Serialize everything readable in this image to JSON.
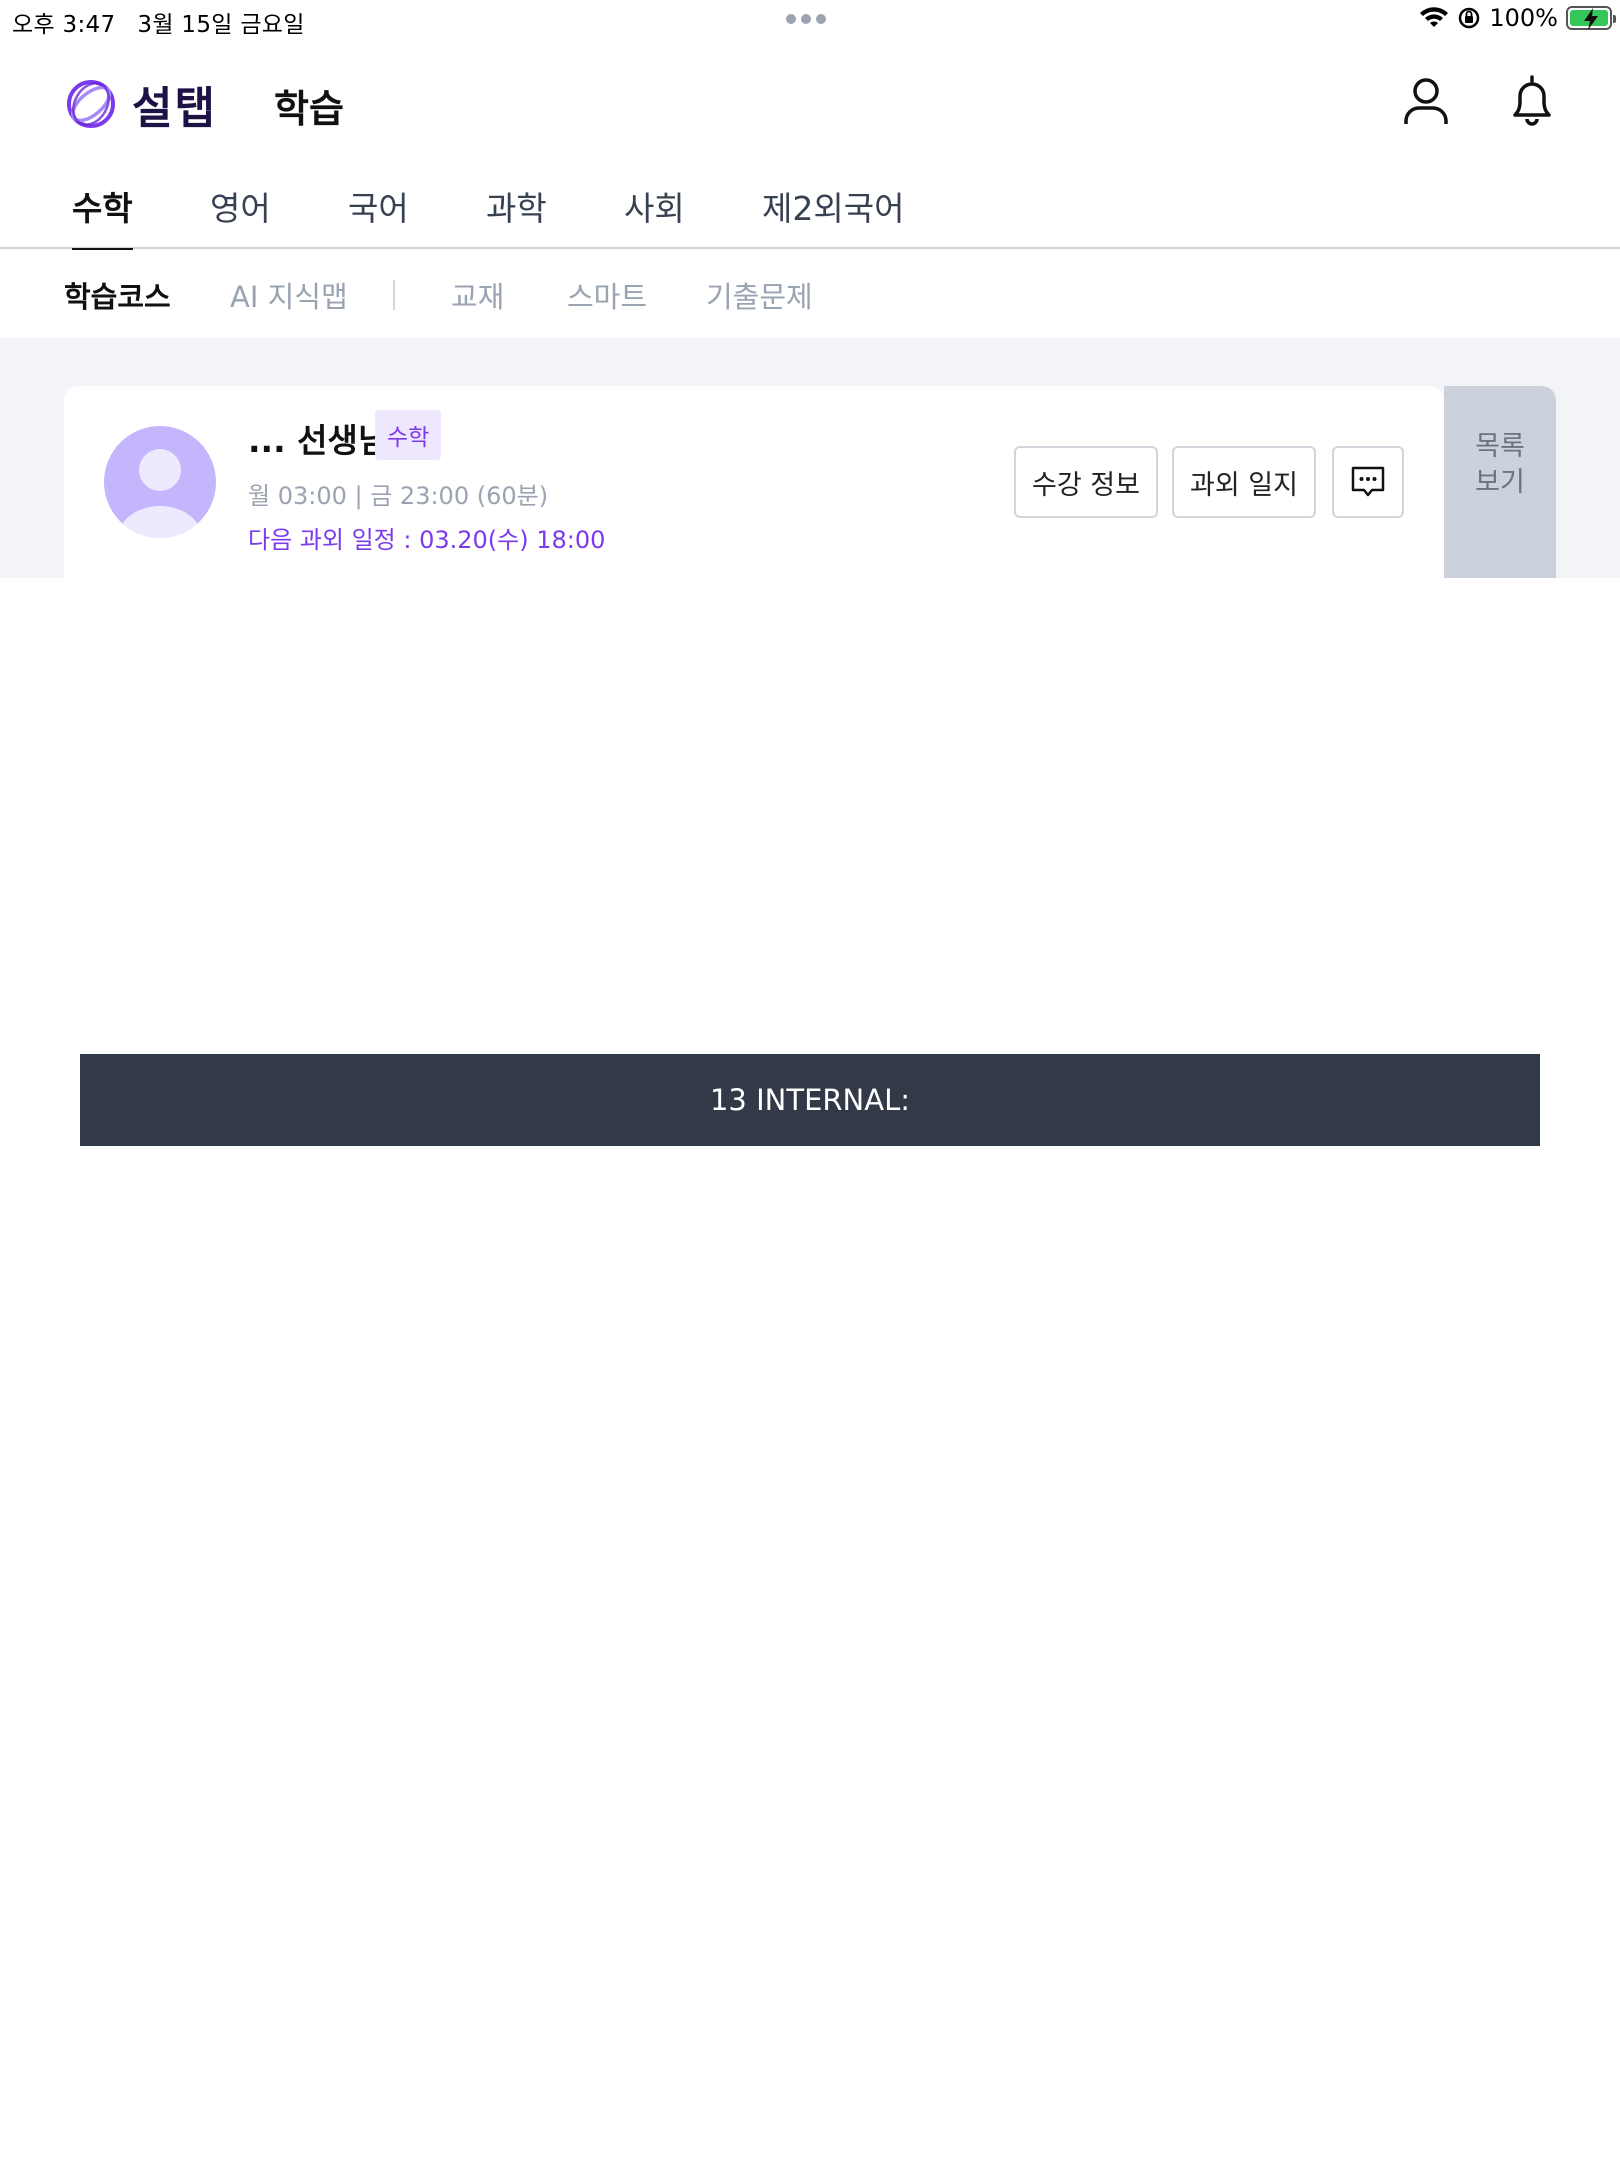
{
  "status_bar": {
    "time": "오후 3:47",
    "date": "3월 15일 금요일",
    "battery": "100%"
  },
  "header": {
    "logo_text": "설탭",
    "title": "학습"
  },
  "subject_tabs": [
    {
      "label": "수학",
      "active": true
    },
    {
      "label": "영어",
      "active": false
    },
    {
      "label": "국어",
      "active": false
    },
    {
      "label": "과학",
      "active": false
    },
    {
      "label": "사회",
      "active": false
    },
    {
      "label": "제2외국어",
      "active": false
    }
  ],
  "sub_tabs": [
    {
      "label": "학습코스",
      "active": true
    },
    {
      "label": "AI 지식맵",
      "active": false
    },
    {
      "label": "교재",
      "active": false
    },
    {
      "label": "스마트",
      "active": false
    },
    {
      "label": "기출문제",
      "active": false
    }
  ],
  "course_card": {
    "teacher_name": "... 선생님",
    "subject_badge": "수학",
    "schedule": "월 03:00 | 금 23:00 (60분)",
    "next_schedule": "다음 과외 일정 : 03.20(수) 18:00",
    "buttons": {
      "course_info": "수강 정보",
      "lesson_log": "과외 일지"
    },
    "list_button": {
      "line1": "목록",
      "line2": "보기"
    }
  },
  "toast": {
    "text": "13 INTERNAL:"
  },
  "colors": {
    "accent": "#7c3aed",
    "brand_dark": "#1e1145",
    "avatar": "#c4b5fd",
    "toast_bg": "#323a47",
    "content_bg": "#f3f4f8"
  }
}
